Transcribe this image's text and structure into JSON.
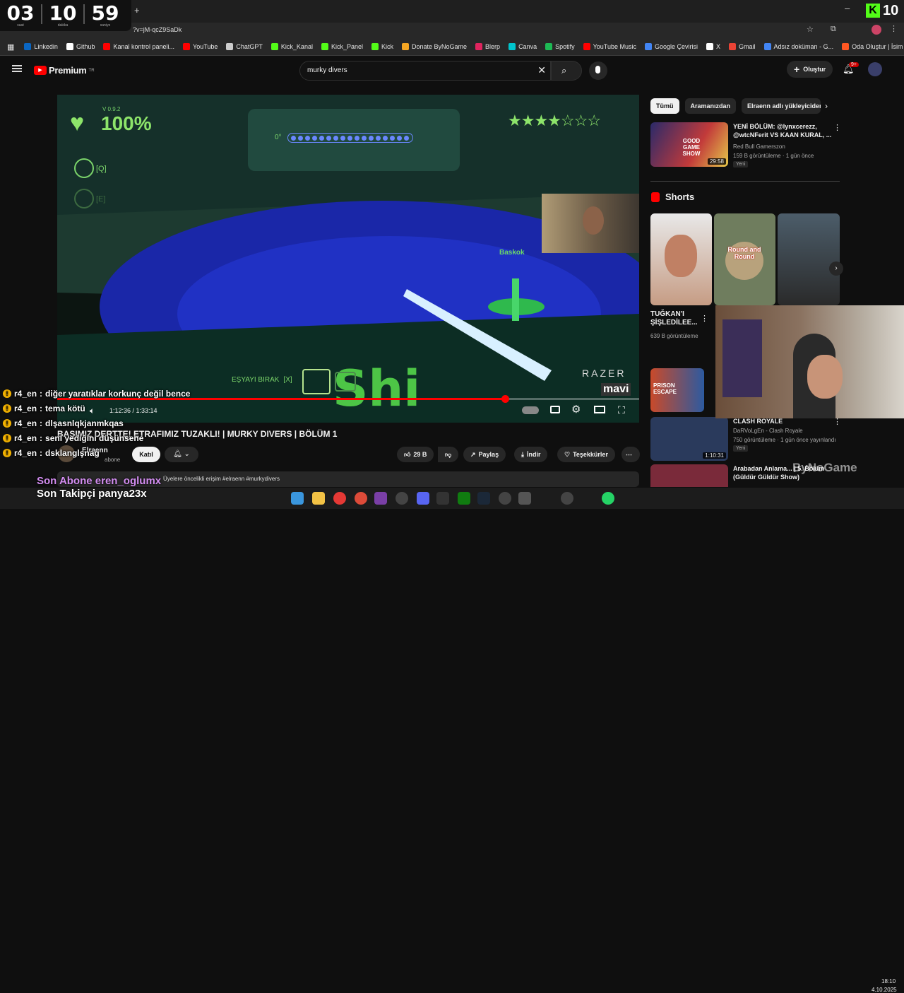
{
  "timer": {
    "hours": "03",
    "minutes": "10",
    "seconds": "59",
    "hours_label": "saat",
    "minutes_label": "dakika",
    "seconds_label": "saniye"
  },
  "kick_count": "10",
  "address": "?v=jM-qcZ9SaDk",
  "bookmarks": [
    {
      "label": "Linkedin",
      "color": "#0a66c2"
    },
    {
      "label": "Github",
      "color": "#ffffff"
    },
    {
      "label": "Kanal kontrol paneli...",
      "color": "#ff0000"
    },
    {
      "label": "YouTube",
      "color": "#ff0000"
    },
    {
      "label": "ChatGPT",
      "color": "#cccccc"
    },
    {
      "label": "Kick_Kanal",
      "color": "#53fc18"
    },
    {
      "label": "Kick_Panel",
      "color": "#53fc18"
    },
    {
      "label": "Kick",
      "color": "#53fc18"
    },
    {
      "label": "Donate ByNoGame",
      "color": "#f5a623"
    },
    {
      "label": "Blerp",
      "color": "#e0245e"
    },
    {
      "label": "Canva",
      "color": "#00c4cc"
    },
    {
      "label": "Spotify",
      "color": "#1db954"
    },
    {
      "label": "YouTube Music",
      "color": "#ff0000"
    },
    {
      "label": "Google Çevirisi",
      "color": "#4285f4"
    },
    {
      "label": "X",
      "color": "#ffffff"
    },
    {
      "label": "Gmail",
      "color": "#ea4335"
    },
    {
      "label": "Adsız doküman - G...",
      "color": "#4285f4"
    },
    {
      "label": "Oda Oluştur | İsim Ş...",
      "color": "#ff5722"
    }
  ],
  "youtube": {
    "logo": "Premium",
    "logo_sup": "TR",
    "search_value": "murky divers",
    "create_label": "Oluştur",
    "notif_count": "9+"
  },
  "game_hud": {
    "version": "V 0.9.2",
    "health": "100%",
    "key_q": "[Q]",
    "key_e": "[E]",
    "depth_label": "0°",
    "drop_label": "EŞYAYI BIRAK",
    "drop_key": "[X]",
    "stars": 4,
    "stars_total": 7,
    "player_tag": "Baskok",
    "razer": "RAZER",
    "mavi": "mavi"
  },
  "player": {
    "time": "1:12:36 / 1:33:14",
    "progress": 0.77
  },
  "video": {
    "title": "BAŞIMIZ DERTTE! ETRAFIMIZ TUZAKLI! | MURKY DIVERS | BÖLÜM 1",
    "channel": "Elraenn",
    "subs": "abone",
    "join": "Katıl",
    "likes": "29 B",
    "share": "Paylaş",
    "download": "İndir",
    "thanks": "Teşekkürler",
    "desc": "Üyelere öncelikli erişim  #elraenn #murkydivers"
  },
  "chat": [
    {
      "user": "r4_en",
      "text": "diğer yaratıklar korkunç değil bence"
    },
    {
      "user": "r4_en",
      "text": "tema kötü"
    },
    {
      "user": "r4_en",
      "text": "dlşasnlqkjanmkqas"
    },
    {
      "user": "r4_en",
      "text": "seni yediğini düşünsene"
    },
    {
      "user": "r4_en",
      "text": "dsklanglşnag"
    }
  ],
  "overlay": {
    "last_sub": "Son Abone eren_oglumx",
    "last_follow": "Son Takipçi panya23x"
  },
  "sidebar": {
    "chips": [
      "Tümü",
      "Aramanızdan",
      "Elraenn adlı yükleyiciden"
    ],
    "rec1": {
      "title": "YENİ BÖLÜM: @lynxcerezz, @wtcNFerit VS KAAN KURAL, ...",
      "channel": "Red Bull Gamerszon",
      "meta": "159 B görüntüleme · 1 gün önce",
      "badge": "Yeni",
      "duration": "29:58",
      "thumb_text": "GOOD GAME SHOW"
    },
    "shorts_title": "Shorts",
    "short1": {
      "title": "TUĞKAN'I ŞİŞLEDİLEE...",
      "views": "639 B görüntüleme"
    },
    "short2_text": "Round and Round",
    "rec2": {
      "title": "CLASH ROYALE",
      "channel": "DaRVoLgEn - Clash Royale",
      "meta": "750 görüntüleme · 1 gün önce yayınlandı",
      "badge": "Yeni",
      "duration": "1:10:31"
    },
    "rec3": {
      "title": "Arabadan Anlama... | 5. Bölüm (Güldür Güldür Show)"
    },
    "rec_prison": "PRISON ESCAPE"
  },
  "taskbar": {
    "clock": "18:10",
    "date": "4.10.2025"
  },
  "watermark": "ByNoGame"
}
